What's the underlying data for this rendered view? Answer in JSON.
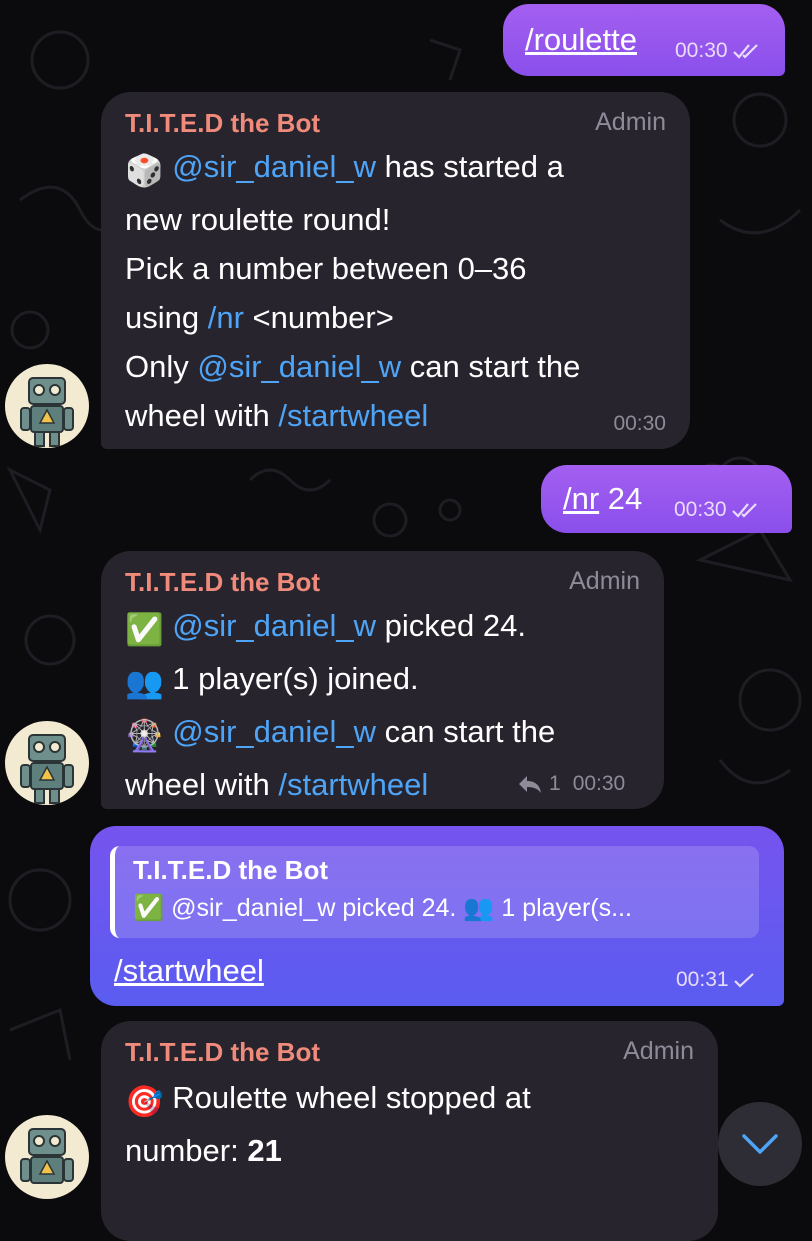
{
  "chat": {
    "out1": {
      "command": "/roulette",
      "time": "00:30"
    },
    "bot1": {
      "sender": "T.I.T.E.D the Bot",
      "role": "Admin",
      "emoji": "🎲",
      "user": "@sir_daniel_w",
      "text1": " has started a",
      "text2": "new roulette round!",
      "text3": "Pick a number between 0–36",
      "text4_pre": "using ",
      "command_nr": "/nr",
      "text4_post": " <number>",
      "text5_pre": "Only ",
      "text5_post": " can start the",
      "text6_pre": "wheel with ",
      "command_start": "/startwheel",
      "time": "00:30"
    },
    "out2": {
      "command": "/nr",
      "arg": " 24",
      "time": "00:30"
    },
    "bot2": {
      "sender": "T.I.T.E.D the Bot",
      "role": "Admin",
      "emoji1": "✅",
      "user1": "@sir_daniel_w",
      "text1": " picked 24.",
      "emoji2": "👥",
      "text2": "1 player(s) joined.",
      "emoji3": "🎡",
      "user2": "@sir_daniel_w",
      "text3": " can start the",
      "text4_pre": "wheel with ",
      "command_start": "/startwheel",
      "reply_count": "1",
      "time": "00:30"
    },
    "out3": {
      "quote_sender": "T.I.T.E.D the Bot",
      "quote_text": "✅ @sir_daniel_w picked 24. 👥 1 player(s...",
      "command": "/startwheel",
      "time": "00:31"
    },
    "bot3": {
      "sender": "T.I.T.E.D the Bot",
      "role": "Admin",
      "emoji": "🎯",
      "text1": " Roulette wheel stopped at",
      "text2_pre": "number: ",
      "number": "21"
    }
  },
  "colors": {
    "background": "#0b0b0d",
    "incoming_bubble": "#27242e",
    "outgoing_bubble": "#9656ee",
    "sender_name": "#f08a7a",
    "link": "#4ea4f6"
  }
}
